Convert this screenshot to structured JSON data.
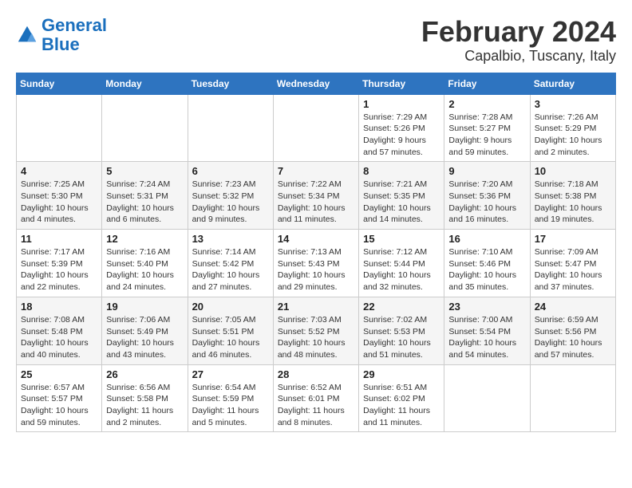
{
  "logo": {
    "line1": "General",
    "line2": "Blue"
  },
  "title": "February 2024",
  "subtitle": "Capalbio, Tuscany, Italy",
  "days_of_week": [
    "Sunday",
    "Monday",
    "Tuesday",
    "Wednesday",
    "Thursday",
    "Friday",
    "Saturday"
  ],
  "weeks": [
    [
      {
        "day": "",
        "info": ""
      },
      {
        "day": "",
        "info": ""
      },
      {
        "day": "",
        "info": ""
      },
      {
        "day": "",
        "info": ""
      },
      {
        "day": "1",
        "info": "Sunrise: 7:29 AM\nSunset: 5:26 PM\nDaylight: 9 hours and 57 minutes."
      },
      {
        "day": "2",
        "info": "Sunrise: 7:28 AM\nSunset: 5:27 PM\nDaylight: 9 hours and 59 minutes."
      },
      {
        "day": "3",
        "info": "Sunrise: 7:26 AM\nSunset: 5:29 PM\nDaylight: 10 hours and 2 minutes."
      }
    ],
    [
      {
        "day": "4",
        "info": "Sunrise: 7:25 AM\nSunset: 5:30 PM\nDaylight: 10 hours and 4 minutes."
      },
      {
        "day": "5",
        "info": "Sunrise: 7:24 AM\nSunset: 5:31 PM\nDaylight: 10 hours and 6 minutes."
      },
      {
        "day": "6",
        "info": "Sunrise: 7:23 AM\nSunset: 5:32 PM\nDaylight: 10 hours and 9 minutes."
      },
      {
        "day": "7",
        "info": "Sunrise: 7:22 AM\nSunset: 5:34 PM\nDaylight: 10 hours and 11 minutes."
      },
      {
        "day": "8",
        "info": "Sunrise: 7:21 AM\nSunset: 5:35 PM\nDaylight: 10 hours and 14 minutes."
      },
      {
        "day": "9",
        "info": "Sunrise: 7:20 AM\nSunset: 5:36 PM\nDaylight: 10 hours and 16 minutes."
      },
      {
        "day": "10",
        "info": "Sunrise: 7:18 AM\nSunset: 5:38 PM\nDaylight: 10 hours and 19 minutes."
      }
    ],
    [
      {
        "day": "11",
        "info": "Sunrise: 7:17 AM\nSunset: 5:39 PM\nDaylight: 10 hours and 22 minutes."
      },
      {
        "day": "12",
        "info": "Sunrise: 7:16 AM\nSunset: 5:40 PM\nDaylight: 10 hours and 24 minutes."
      },
      {
        "day": "13",
        "info": "Sunrise: 7:14 AM\nSunset: 5:42 PM\nDaylight: 10 hours and 27 minutes."
      },
      {
        "day": "14",
        "info": "Sunrise: 7:13 AM\nSunset: 5:43 PM\nDaylight: 10 hours and 29 minutes."
      },
      {
        "day": "15",
        "info": "Sunrise: 7:12 AM\nSunset: 5:44 PM\nDaylight: 10 hours and 32 minutes."
      },
      {
        "day": "16",
        "info": "Sunrise: 7:10 AM\nSunset: 5:46 PM\nDaylight: 10 hours and 35 minutes."
      },
      {
        "day": "17",
        "info": "Sunrise: 7:09 AM\nSunset: 5:47 PM\nDaylight: 10 hours and 37 minutes."
      }
    ],
    [
      {
        "day": "18",
        "info": "Sunrise: 7:08 AM\nSunset: 5:48 PM\nDaylight: 10 hours and 40 minutes."
      },
      {
        "day": "19",
        "info": "Sunrise: 7:06 AM\nSunset: 5:49 PM\nDaylight: 10 hours and 43 minutes."
      },
      {
        "day": "20",
        "info": "Sunrise: 7:05 AM\nSunset: 5:51 PM\nDaylight: 10 hours and 46 minutes."
      },
      {
        "day": "21",
        "info": "Sunrise: 7:03 AM\nSunset: 5:52 PM\nDaylight: 10 hours and 48 minutes."
      },
      {
        "day": "22",
        "info": "Sunrise: 7:02 AM\nSunset: 5:53 PM\nDaylight: 10 hours and 51 minutes."
      },
      {
        "day": "23",
        "info": "Sunrise: 7:00 AM\nSunset: 5:54 PM\nDaylight: 10 hours and 54 minutes."
      },
      {
        "day": "24",
        "info": "Sunrise: 6:59 AM\nSunset: 5:56 PM\nDaylight: 10 hours and 57 minutes."
      }
    ],
    [
      {
        "day": "25",
        "info": "Sunrise: 6:57 AM\nSunset: 5:57 PM\nDaylight: 10 hours and 59 minutes."
      },
      {
        "day": "26",
        "info": "Sunrise: 6:56 AM\nSunset: 5:58 PM\nDaylight: 11 hours and 2 minutes."
      },
      {
        "day": "27",
        "info": "Sunrise: 6:54 AM\nSunset: 5:59 PM\nDaylight: 11 hours and 5 minutes."
      },
      {
        "day": "28",
        "info": "Sunrise: 6:52 AM\nSunset: 6:01 PM\nDaylight: 11 hours and 8 minutes."
      },
      {
        "day": "29",
        "info": "Sunrise: 6:51 AM\nSunset: 6:02 PM\nDaylight: 11 hours and 11 minutes."
      },
      {
        "day": "",
        "info": ""
      },
      {
        "day": "",
        "info": ""
      }
    ]
  ]
}
